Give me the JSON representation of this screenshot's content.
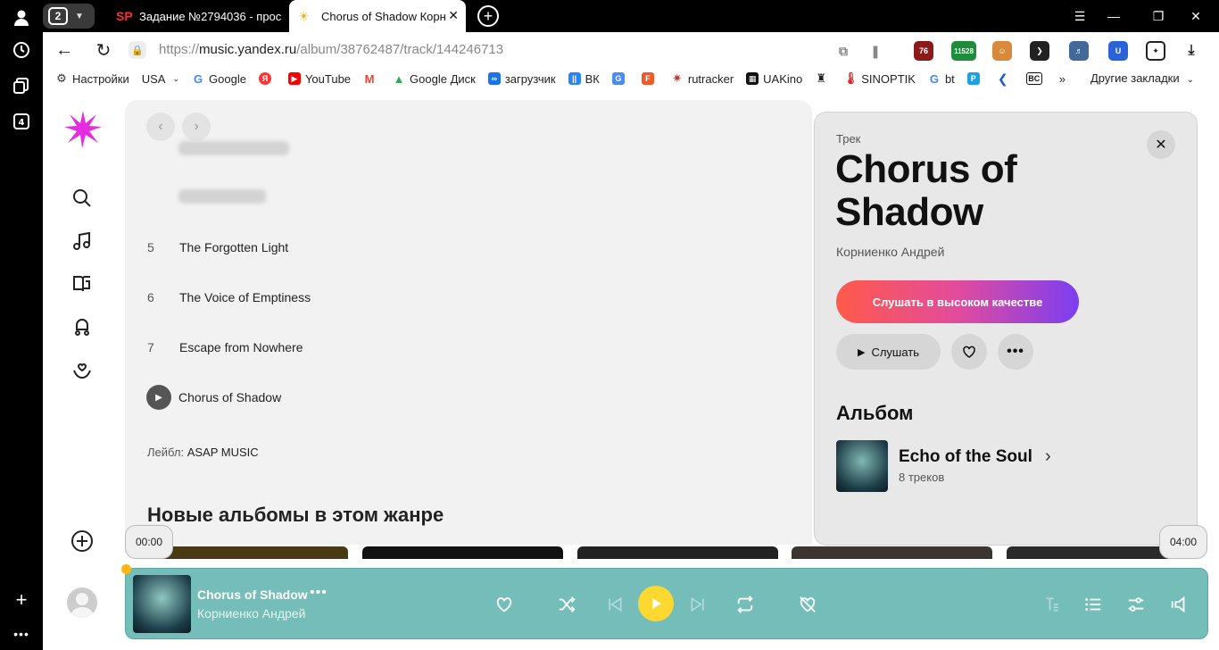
{
  "browser": {
    "tab_count": "2",
    "tabs": [
      {
        "favicon": "SP",
        "title": "Задание №2794036 - прос"
      },
      {
        "favicon": "☀",
        "title": "Chorus of Shadow Корн"
      }
    ],
    "url_prefix": "https://",
    "url_host": "music.yandex.ru",
    "url_path": "/album/38762487/track/144246713",
    "extensions": [
      "76",
      "11528"
    ],
    "bookmarks": [
      {
        "label": "Настройки",
        "icon": "gear-icon"
      },
      {
        "label": "USA",
        "icon": "chevron-down-icon"
      },
      {
        "label": "Google",
        "icon": "google-icon"
      },
      {
        "label": "",
        "icon": "yandex-icon"
      },
      {
        "label": "YouTube",
        "icon": "youtube-icon"
      },
      {
        "label": "",
        "icon": "gmail-icon"
      },
      {
        "label": "Google Диск",
        "icon": "drive-icon"
      },
      {
        "label": "загрузчик",
        "icon": "loop-icon"
      },
      {
        "label": "ВК",
        "icon": "vk-icon"
      },
      {
        "label": "",
        "icon": "translate-icon"
      },
      {
        "label": "",
        "icon": "f-icon"
      },
      {
        "label": "rutracker",
        "icon": "rutracker-icon"
      },
      {
        "label": "UAKino",
        "icon": "uakino-icon"
      },
      {
        "label": "",
        "icon": "figure-icon"
      },
      {
        "label": "SINOPTIK",
        "icon": "thermometer-icon"
      },
      {
        "label": "bt",
        "icon": "google-icon"
      },
      {
        "label": "",
        "icon": "p-icon"
      },
      {
        "label": "",
        "icon": "k-icon"
      },
      {
        "label": "",
        "icon": "bc-icon"
      }
    ],
    "more_bookmarks": "»",
    "other_bookmarks": "Другие закладки"
  },
  "tracklist": {
    "tracks": [
      {
        "num": "5",
        "title": "The Forgotten Light"
      },
      {
        "num": "6",
        "title": "The Voice of Emptiness"
      },
      {
        "num": "7",
        "title": "Escape from Nowhere"
      },
      {
        "num": "",
        "title": "Chorus of Shadow"
      }
    ],
    "label_prefix": "Лейбл:",
    "label_value": "ASAP MUSIC",
    "new_albums_title": "Новые альбомы в этом жанре"
  },
  "panel": {
    "kicker": "Трек",
    "title": "Chorus of Shadow",
    "artist": "Корниенко Андрей",
    "hq_button": "Слушать в высоком качестве",
    "listen_button": "Слушать",
    "album_heading": "Альбом",
    "album_name": "Echo of the Soul",
    "album_count": "8 треков"
  },
  "player": {
    "time_current": "00:00",
    "time_total": "04:00",
    "title": "Chorus of Shadow",
    "artist": "Корниенко Андрей",
    "progress": 0,
    "colors": {
      "background": "#74bdb9",
      "play_button": "#fcd831",
      "progress_dot": "#fbb612"
    }
  },
  "colors": {
    "hq_gradient_start": "#ff5a4a",
    "hq_gradient_end": "#7b3ff2",
    "logo": "#e62ce0"
  }
}
